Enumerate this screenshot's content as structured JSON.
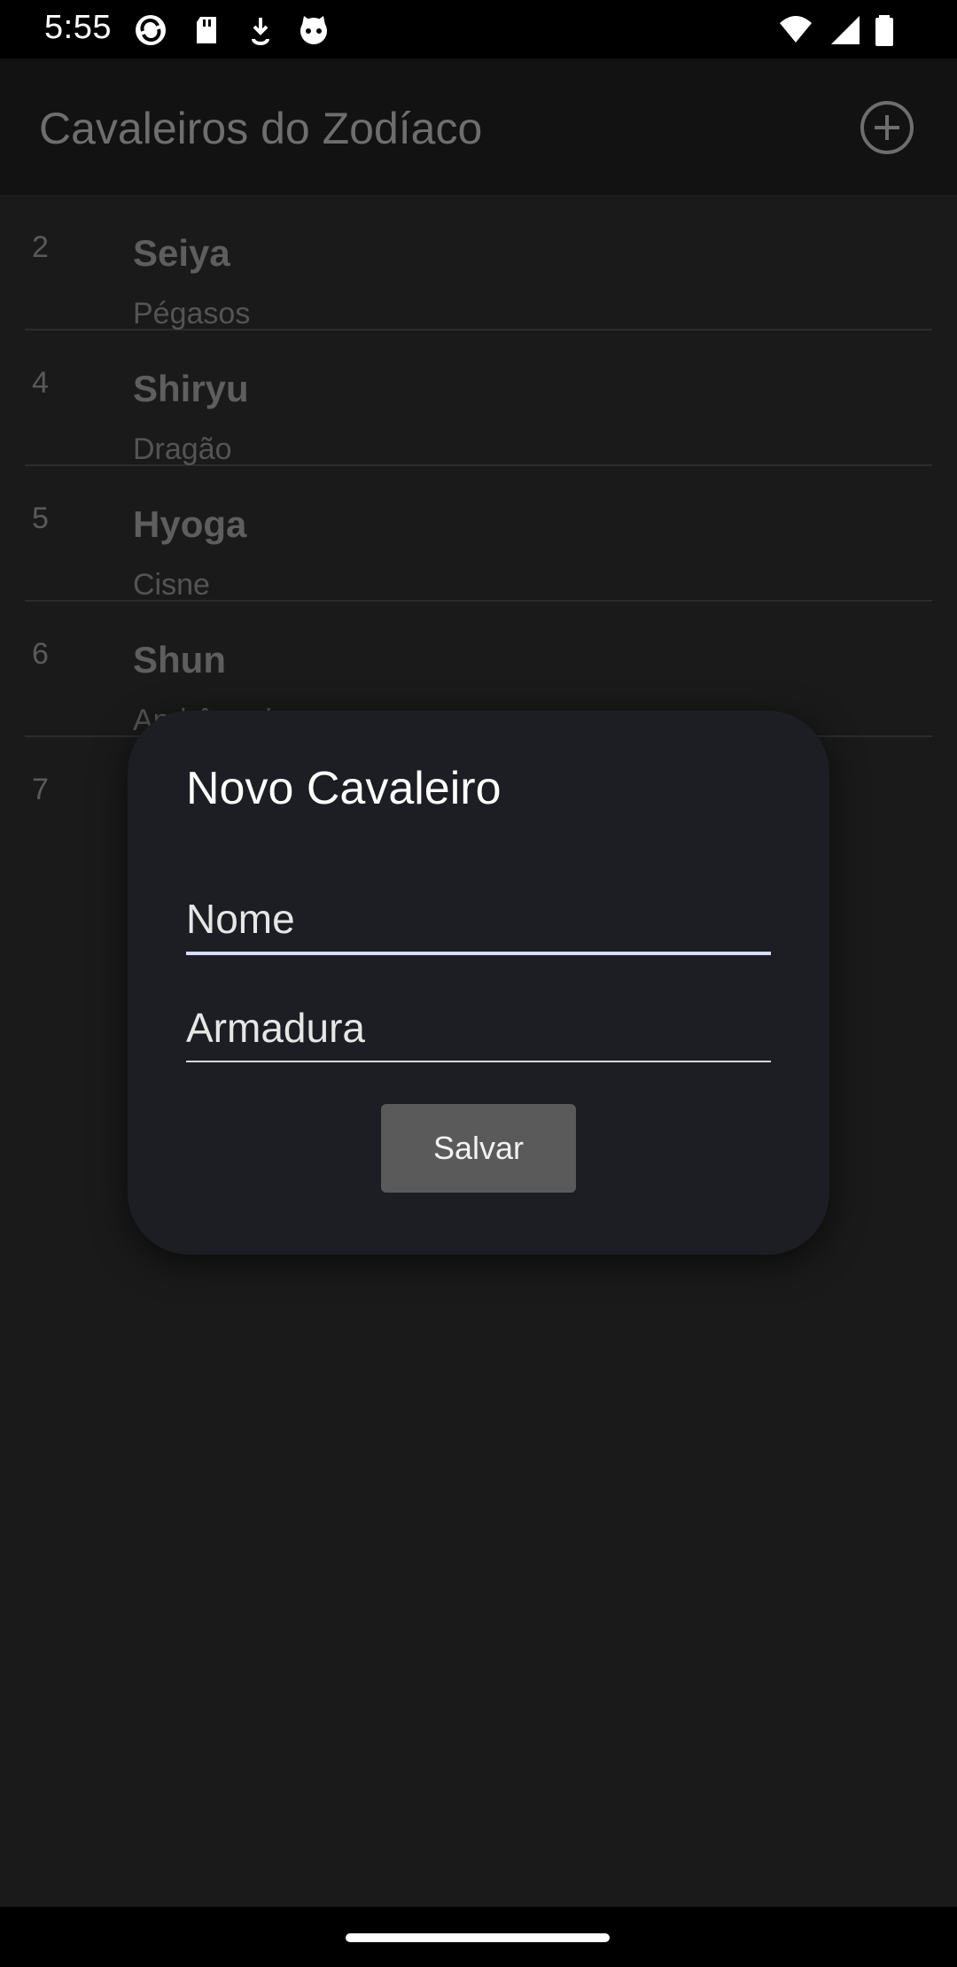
{
  "status_bar": {
    "time": "5:55",
    "icons": [
      "sync-icon",
      "sd-card-icon",
      "download-icon",
      "cat-icon",
      "wifi-icon",
      "signal-icon",
      "battery-icon"
    ]
  },
  "app_bar": {
    "title": "Cavaleiros do Zodíaco",
    "action_icon": "add-circle-icon"
  },
  "list": {
    "items": [
      {
        "id": "2",
        "name": "Seiya",
        "armor": "Pégasos"
      },
      {
        "id": "4",
        "name": "Shiryu",
        "armor": "Dragão"
      },
      {
        "id": "5",
        "name": "Hyoga",
        "armor": "Cisne"
      },
      {
        "id": "6",
        "name": "Shun",
        "armor": "Andrômeda"
      },
      {
        "id": "7",
        "name": "",
        "armor": ""
      }
    ]
  },
  "dialog": {
    "title": "Novo Cavaleiro",
    "name_field": {
      "placeholder": "Nome",
      "value": ""
    },
    "armor_field": {
      "placeholder": "Armadura",
      "value": ""
    },
    "save_label": "Salvar"
  },
  "colors": {
    "background": "#1a1a1a",
    "dialog": "#1d1e23",
    "accent_underline": "#d9dcff",
    "button": "#5a5a5a"
  }
}
